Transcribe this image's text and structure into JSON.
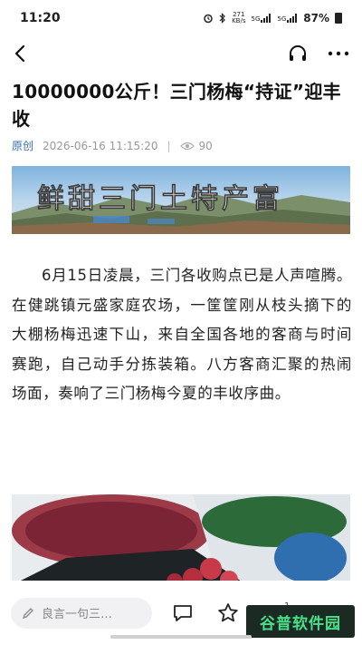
{
  "status_bar": {
    "time": "11:20",
    "net_speed_top": "271",
    "net_speed_bottom": "KB/s",
    "signal1": "5G",
    "signal2": "5G",
    "battery": "87%"
  },
  "nav": {
    "back_icon": "chevron-left-icon",
    "listen_icon": "headphones-icon",
    "more_icon": "more-icon"
  },
  "article": {
    "title": "10000000公斤！三门杨梅“持证”迎丰收",
    "source": "原创",
    "date": "2026-06-16 11:15:20",
    "separator": "|",
    "views": "90",
    "banner_text": "鲜甜三门土特产富",
    "body": "6月15日凌晨，三门各收购点已是人声喧腾。在健跳镇元盛家庭农场，一筐筐刚从枝头摘下的大棚杨梅迅速下山，来自全国各地的客商与时间赛跑，自己动手分拣装箱。八方客商汇聚的热闹场面，奏响了三门杨梅今夏的丰收序曲。"
  },
  "bottom_bar": {
    "comment_placeholder": "良言一句三…",
    "like_count": "1"
  },
  "watermark": "谷普软件园",
  "colors": {
    "source_link": "#3a6ea8",
    "meta_gray": "#999999",
    "watermark_bg": "#1c2a24",
    "watermark_fg": "#49e08a"
  }
}
